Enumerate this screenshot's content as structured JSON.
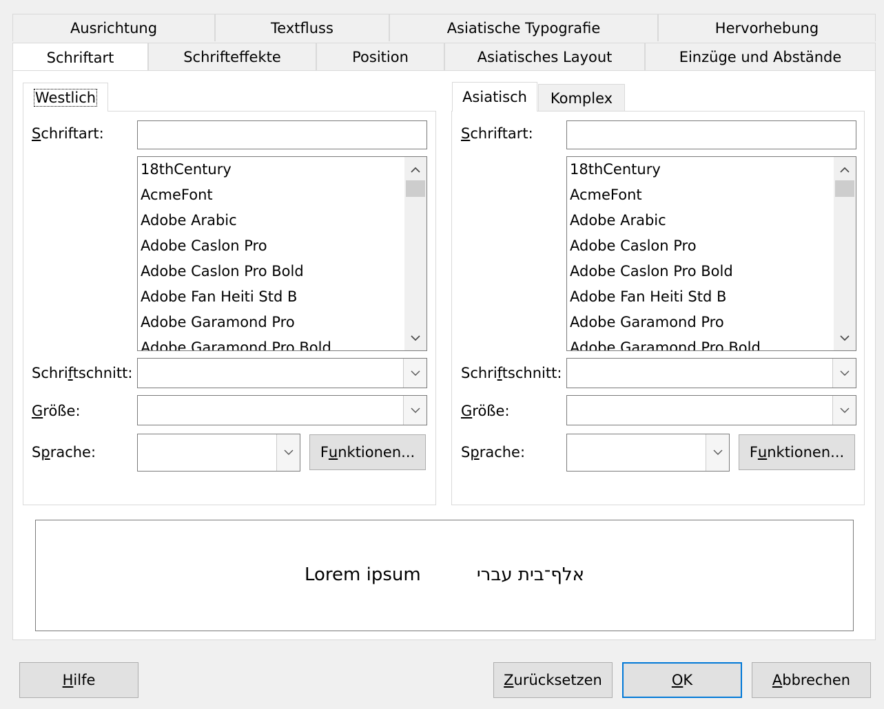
{
  "tabs": {
    "row1": [
      "Ausrichtung",
      "Textfluss",
      "Asiatische Typografie",
      "Hervorhebung"
    ],
    "row2": [
      "Schriftart",
      "Schrifteffekte",
      "Position",
      "Asiatisches Layout",
      "Einzüge und Abstände"
    ],
    "active": "Schriftart"
  },
  "western": {
    "tab_label": "Westlich",
    "font_label_pre": "",
    "font_label_accel": "S",
    "font_label_post": "chriftart:",
    "font_value": "",
    "font_list": [
      "18thCentury",
      "AcmeFont",
      "Adobe Arabic",
      "Adobe Caslon Pro",
      "Adobe Caslon Pro Bold",
      "Adobe Fan Heiti Std B",
      "Adobe Garamond Pro",
      "Adobe Garamond Pro Bold"
    ],
    "style_label_pre": "Schri",
    "style_label_accel": "f",
    "style_label_post": "tschnitt:",
    "style_value": "",
    "size_label_pre": "",
    "size_label_accel": "G",
    "size_label_post": "röße:",
    "size_value": "",
    "lang_label_pre": "S",
    "lang_label_accel": "p",
    "lang_label_post": "rache:",
    "lang_value": "",
    "features_pre": "F",
    "features_accel": "u",
    "features_post": "nktionen..."
  },
  "asian": {
    "tab_label": "Asiatisch",
    "tab2_label": "Komplex",
    "font_label_pre": "",
    "font_label_accel": "S",
    "font_label_post": "chriftart:",
    "font_value": "",
    "font_list": [
      "18thCentury",
      "AcmeFont",
      "Adobe Arabic",
      "Adobe Caslon Pro",
      "Adobe Caslon Pro Bold",
      "Adobe Fan Heiti Std B",
      "Adobe Garamond Pro",
      "Adobe Garamond Pro Bold"
    ],
    "style_label_pre": "Schri",
    "style_label_accel": "f",
    "style_label_post": "tschnitt:",
    "style_value": "",
    "size_label_pre": "",
    "size_label_accel": "G",
    "size_label_post": "röße:",
    "size_value": "",
    "lang_label_pre": "S",
    "lang_label_accel": "p",
    "lang_label_post": "rache:",
    "lang_value": "",
    "features_pre": "F",
    "features_accel": "u",
    "features_post": "nktionen..."
  },
  "preview": {
    "latin": "Lorem ipsum",
    "hebrew": "אלף־בית עברי"
  },
  "buttons": {
    "help_accel": "H",
    "help_post": "ilfe",
    "reset_accel": "Z",
    "reset_post": "urücksetzen",
    "ok_accel": "O",
    "ok_post": "K",
    "cancel_accel": "A",
    "cancel_post": "bbrechen"
  }
}
